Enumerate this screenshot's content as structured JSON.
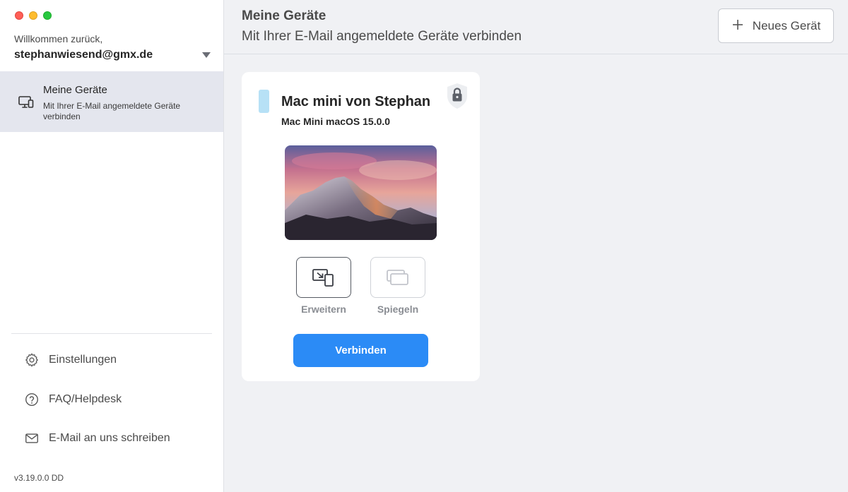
{
  "window": {
    "traffic_lights": [
      "close",
      "minimize",
      "zoom"
    ]
  },
  "sidebar": {
    "welcome": "Willkommen zurück,",
    "account_email": "stephanwiesend@gmx.de",
    "nav_items": [
      {
        "title": "Meine Geräte",
        "subtitle": "Mit Ihrer E-Mail angemeldete Geräte verbinden",
        "icon": "monitor-devices-icon",
        "active": true
      }
    ],
    "menu": [
      {
        "label": "Einstellungen",
        "icon": "gear-icon"
      },
      {
        "label": "FAQ/Helpdesk",
        "icon": "question-circle-icon"
      },
      {
        "label": "E-Mail an uns schreiben",
        "icon": "envelope-icon"
      }
    ],
    "version": "v3.19.0.0 DD"
  },
  "header": {
    "title": "Meine Geräte",
    "subtitle": "Mit Ihrer E-Mail angemeldete Geräte verbinden",
    "new_device_label": "Neues Gerät",
    "new_device_icon": "plus-icon"
  },
  "device": {
    "name": "Mac mini von Stephan",
    "info": "Mac Mini macOS 15.0.0",
    "tag_color": "#b7e1f6",
    "lock_icon": "lock-icon",
    "modes": [
      {
        "label": "Erweitern",
        "icon": "extend-display-icon",
        "selected": true
      },
      {
        "label": "Spiegeln",
        "icon": "mirror-display-icon",
        "selected": false
      }
    ],
    "connect_label": "Verbinden"
  },
  "colors": {
    "accent": "#2b8bf6",
    "active_nav_bg": "#e4e6ee",
    "background": "#f0f1f4"
  }
}
